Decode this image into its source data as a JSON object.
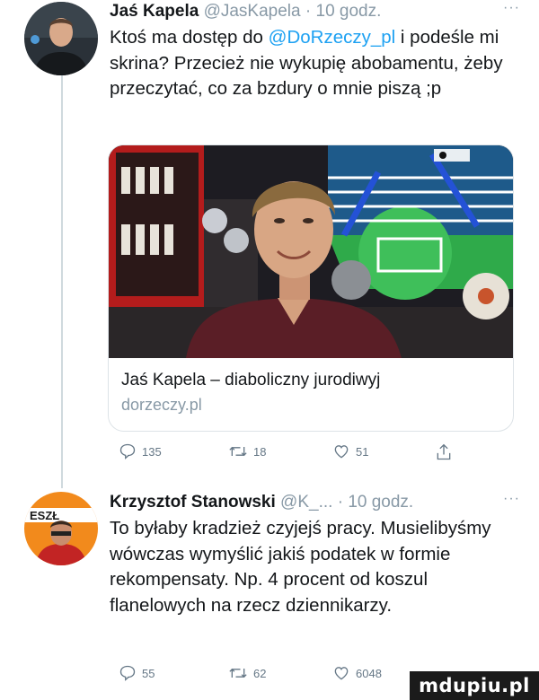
{
  "tweets": [
    {
      "author_name": "Jaś Kapela",
      "handle": "@JasKapela",
      "separator": " · ",
      "time": "10 godz.",
      "more": "···",
      "text_before": "Ktoś ma dostęp do ",
      "mention": "@DoRzeczy_pl",
      "text_after": " i podeśle mi skrina? Przecież nie wykupię abobamentu, żeby przeczytać, co za bzdury o mnie piszą ;p",
      "card": {
        "title": "Jaś Kapela – diaboliczny jurodiwyj",
        "domain": "dorzeczy.pl"
      },
      "stats": {
        "replies": "135",
        "retweets": "18",
        "likes": "51"
      }
    },
    {
      "author_name": "Krzysztof Stanowski",
      "handle": "@K_...",
      "separator": " · ",
      "time": "10 godz.",
      "more": "···",
      "text": "To byłaby kradzież czyjejś pracy. Musielibyśmy wówczas wymyślić jakiś podatek w formie rekompensaty. Np. 4 procent od koszul flanelowych na rzecz dziennikarzy.",
      "stats": {
        "replies": "55",
        "retweets": "62",
        "likes": "6048"
      }
    }
  ],
  "watermark": "mdupiu.pl",
  "colors": {
    "link": "#1da1f2",
    "muted": "#8899a6",
    "text": "#14171a"
  },
  "icons": [
    "reply-icon",
    "retweet-icon",
    "like-icon",
    "share-icon"
  ]
}
